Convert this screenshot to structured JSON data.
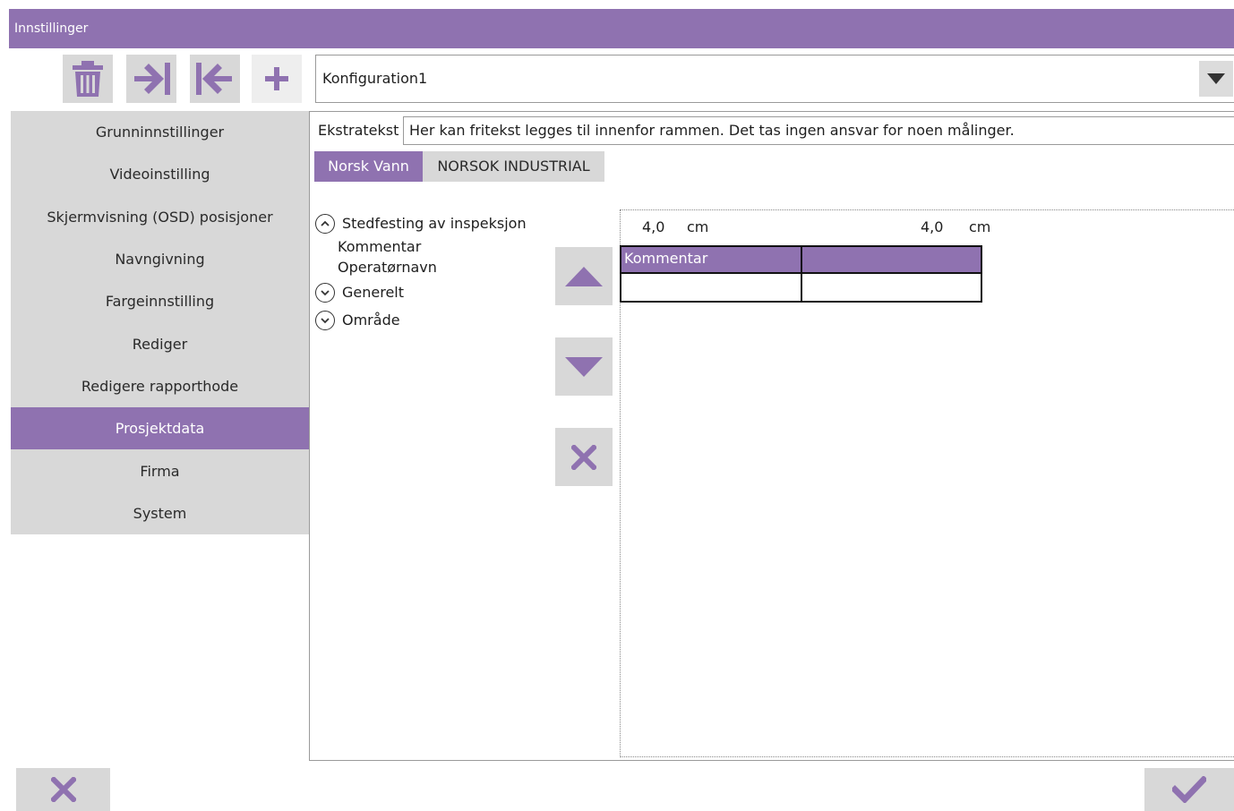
{
  "window": {
    "title": "Innstillinger"
  },
  "toolbar": {
    "buttons": [
      {
        "name": "delete",
        "icon": "trash-icon"
      },
      {
        "name": "import",
        "icon": "arrow-right-bar-icon"
      },
      {
        "name": "export",
        "icon": "arrow-left-bar-icon"
      },
      {
        "name": "add",
        "icon": "plus-icon"
      }
    ],
    "config_value": "Konfiguration1",
    "dropdown_icon": "chevron-down-icon"
  },
  "sidebar": {
    "items": [
      {
        "label": "Grunninnstillinger",
        "active": false
      },
      {
        "label": "Videoinstilling",
        "active": false
      },
      {
        "label": "Skjermvisning (OSD) posisjoner",
        "active": false
      },
      {
        "label": "Navngivning",
        "active": false
      },
      {
        "label": "Fargeinnstilling",
        "active": false
      },
      {
        "label": "Rediger",
        "active": false
      },
      {
        "label": "Redigere rapporthode",
        "active": false
      },
      {
        "label": "Prosjektdata",
        "active": true
      },
      {
        "label": "Firma",
        "active": false
      },
      {
        "label": "System",
        "active": false
      }
    ]
  },
  "main": {
    "extra_text_label": "Ekstratekst",
    "extra_text_value": "Her kan fritekst legges til innenfor rammen. Det tas ingen ansvar for noen målinger.",
    "tabs": [
      {
        "label": "Norsk Vann",
        "active": true
      },
      {
        "label": "NORSOK INDUSTRIAL",
        "active": false
      }
    ],
    "tree": {
      "group1": "Stedfesting av inspeksjon",
      "group1_children": [
        "Kommentar",
        "Operatørnavn"
      ],
      "group2": "Generelt",
      "group3": "Område"
    },
    "preview": {
      "col1_width": "4,0",
      "col2_width": "4,0",
      "unit": "cm",
      "header_col1": "Kommentar",
      "header_col2": ""
    }
  },
  "colors": {
    "accent": "#8f72b0",
    "button_bg": "#d8d8d8"
  }
}
